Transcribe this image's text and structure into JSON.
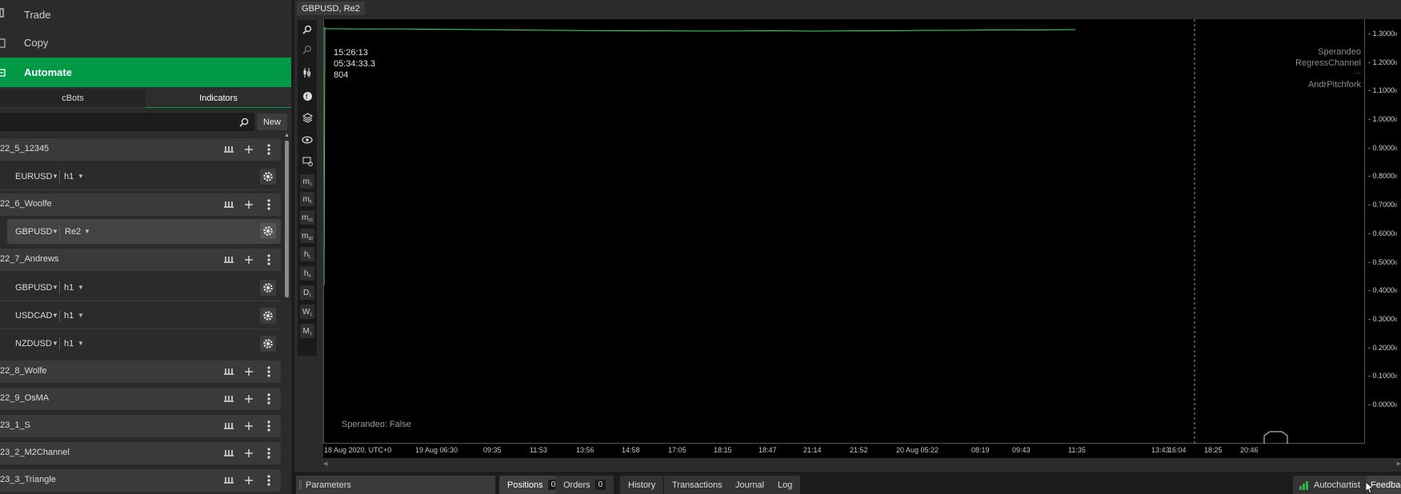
{
  "nav": {
    "trade": "Trade",
    "copy": "Copy",
    "automate": "Automate"
  },
  "tabs": {
    "cbots": "cBots",
    "indicators": "Indicators"
  },
  "search": {
    "placeholder": ""
  },
  "new_button": "New",
  "bots": [
    {
      "name": "22_5_12345",
      "instances": [
        {
          "symbol": "EURUSD",
          "timeframe": "h1"
        }
      ]
    },
    {
      "name": "22_6_Woolfe",
      "instances": [
        {
          "symbol": "GBPUSD",
          "timeframe": "Re2",
          "selected": true
        }
      ]
    },
    {
      "name": "22_7_Andrews",
      "instances": [
        {
          "symbol": "GBPUSD",
          "timeframe": "h1"
        },
        {
          "symbol": "USDCAD",
          "timeframe": "h1"
        },
        {
          "symbol": "NZDUSD",
          "timeframe": "h1"
        }
      ]
    },
    {
      "name": "22_8_Wolfe",
      "instances": []
    },
    {
      "name": "22_9_OsMA",
      "instances": []
    },
    {
      "name": "23_1_S",
      "instances": []
    },
    {
      "name": "23_2_M2Channel",
      "instances": []
    },
    {
      "name": "23_3_Triangle",
      "instances": []
    }
  ],
  "chart": {
    "tab_title": "GBPUSD, Re2",
    "info_lines": [
      "15:26:13",
      "05:34:33.3",
      "804"
    ],
    "legend": [
      "Sperandeo",
      "RegressChannel",
      "...",
      "AndrPitchfork"
    ],
    "status_text": "Sperandeo: False",
    "timeframe_buttons": [
      {
        "main": "m",
        "sub": "1"
      },
      {
        "main": "m",
        "sub": "5"
      },
      {
        "main": "m",
        "sub": "15"
      },
      {
        "main": "m",
        "sub": "30"
      },
      {
        "main": "h",
        "sub": "1"
      },
      {
        "main": "h",
        "sub": "4"
      },
      {
        "main": "D",
        "sub": "1"
      },
      {
        "main": "W",
        "sub": "1"
      },
      {
        "main": "M",
        "sub": "1"
      }
    ],
    "y_ticks": [
      "1.3000",
      "1.2000",
      "1.1000",
      "1.0000",
      "0.9000",
      "0.8000",
      "0.7000",
      "0.6000",
      "0.5000",
      "0.4000",
      "0.3000",
      "0.2000",
      "0.1000",
      "0.0000"
    ],
    "y_tick_suffix": "0",
    "x_ticks": [
      "18 Aug 2020, UTC+0",
      "19 Aug 06:30",
      "09:35",
      "11:53",
      "13:56",
      "14:58",
      "17:05",
      "18:15",
      "18:47",
      "21:14",
      "21:52",
      "20 Aug 05:22",
      "08:19",
      "09:43",
      "11:35",
      "13:43",
      "16:04",
      "18:25",
      "20:46"
    ],
    "line_color": "#3ddc6a",
    "price_value": 1.32
  },
  "bottom": {
    "parameters": "Parameters",
    "positions": "Positions",
    "positions_count": "0",
    "orders": "Orders",
    "orders_count": "0",
    "history": "History",
    "transactions": "Transactions",
    "journal": "Journal",
    "log": "Log",
    "autochartist": "Autochartist",
    "feedback": "Feedback"
  },
  "colors": {
    "accent": "#009a46",
    "background": "#2b2b2b",
    "chart_bg": "#000000"
  }
}
